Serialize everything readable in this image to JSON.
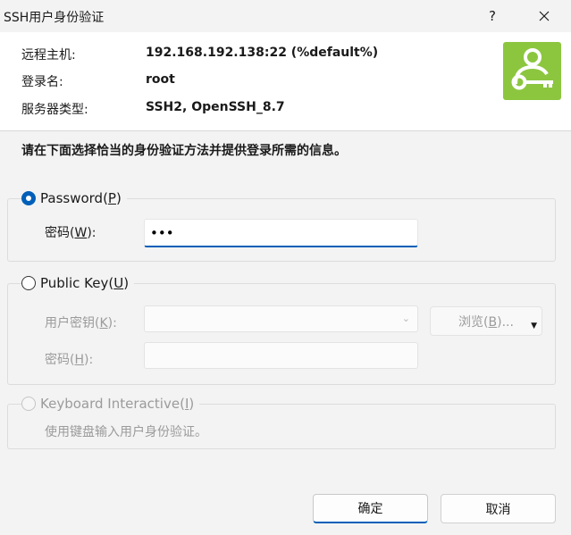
{
  "window": {
    "title": "SSH用户身份验证",
    "help_label": "?"
  },
  "info": {
    "host_label": "远程主机:",
    "host_value": "192.168.192.138:22 (%default%)",
    "login_label": "登录名:",
    "login_value": "root",
    "server_label": "服务器类型:",
    "server_value": "SSH2, OpenSSH_8.7",
    "icon": "user-key-icon",
    "icon_color": "#8cc63f"
  },
  "instruction": "请在下面选择恰当的身份验证方法并提供登录所需的信息。",
  "password_group": {
    "label_main": "Password(",
    "label_key": "P",
    "label_end": ")",
    "selected": true,
    "field_label_main": "密码(",
    "field_label_key": "W",
    "field_label_end": "):",
    "value": "•••"
  },
  "public_key_group": {
    "label_main": "Public Key(",
    "label_key": "U",
    "label_end": ")",
    "selected": false,
    "user_key_label_main": "用户密钥(",
    "user_key_label_key": "K",
    "user_key_label_end": "):",
    "browse_label_main": "浏览(",
    "browse_label_key": "B",
    "browse_label_end": ")...",
    "passphrase_label_main": "密码(",
    "passphrase_label_key": "H",
    "passphrase_label_end": "):"
  },
  "keyboard_group": {
    "label_main": "Keyboard Interactive(",
    "label_key": "I",
    "label_end": ")",
    "selected": false,
    "description": "使用键盘输入用户身份验证。"
  },
  "buttons": {
    "ok": "确定",
    "cancel": "取消"
  },
  "colors": {
    "accent": "#005fb8",
    "icon_bg": "#8cc63f"
  }
}
